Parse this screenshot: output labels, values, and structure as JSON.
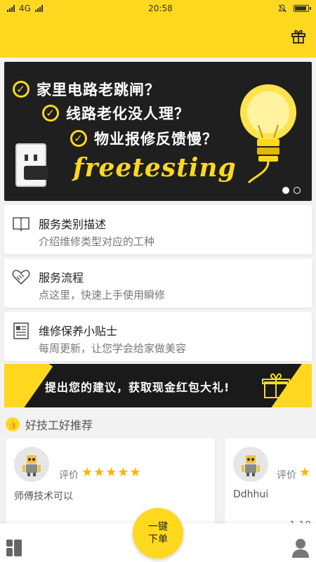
{
  "status_bar": {
    "left": "4G",
    "time": "20:58"
  },
  "banner": {
    "questions": [
      "家里电路老跳闸？",
      "线路老化没人理？",
      "物业报修反馈慢？"
    ],
    "slogan": "freetesting",
    "pager": {
      "count": 2,
      "active": 0
    }
  },
  "menu": [
    {
      "title": "服务类别描述",
      "subtitle": "介绍维修类型对应的工种",
      "icon": "book-icon"
    },
    {
      "title": "服务流程",
      "subtitle": "点这里，快速上手使用瞬修",
      "icon": "heart-handshake-icon"
    },
    {
      "title": "维修保养小贴士",
      "subtitle": "每周更新，让您学会给家做美容",
      "icon": "document-icon"
    }
  ],
  "promo": {
    "text": "提出您的建议，获取现金红包大礼!"
  },
  "recommend": {
    "title": "好技工好推荐",
    "workers": [
      {
        "rating_label": "评价",
        "stars": "★★★★★",
        "desc": "师傅技术可以"
      },
      {
        "rating_label": "评价",
        "stars": "★",
        "desc": "Ddhhui",
        "extra": "1.18"
      }
    ]
  },
  "bottom_nav": {
    "order_line1": "一键",
    "order_line2": "下单"
  },
  "colors": {
    "brand": "#ffd81f",
    "dark": "#1f1f1f",
    "star": "#ffb400"
  }
}
